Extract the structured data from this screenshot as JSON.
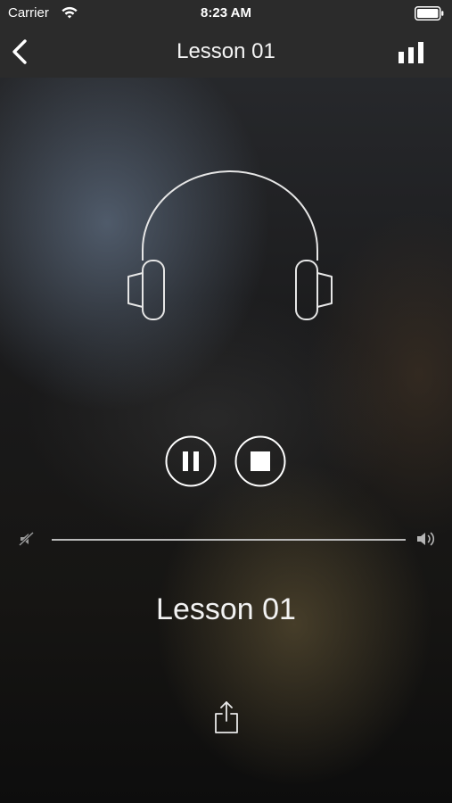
{
  "status_bar": {
    "carrier": "Carrier",
    "time": "8:23 AM",
    "icons": [
      "wifi-icon",
      "battery-icon"
    ]
  },
  "nav_bar": {
    "title": "Lesson 01",
    "left_icon": "chevron-left-icon",
    "right_icon": "bar-chart-icon"
  },
  "player": {
    "artwork_icon": "headphones-icon",
    "controls": [
      "pause-icon",
      "stop-icon"
    ],
    "volume_level": 1.0,
    "volume_icons": [
      "volume-mute-icon",
      "volume-high-icon"
    ],
    "track_title": "Lesson 01",
    "share_icon": "share-icon"
  },
  "colors": {
    "bar_background": "#2b2b2b",
    "foreground": "#ffffff",
    "track": "#b9b9b9"
  }
}
